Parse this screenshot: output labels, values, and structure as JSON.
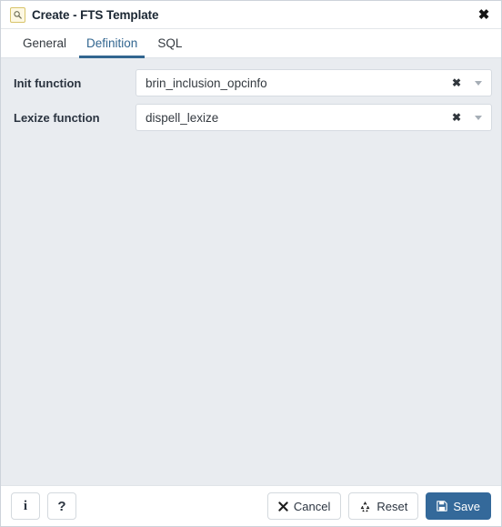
{
  "window": {
    "title": "Create - FTS Template",
    "title_icon": "fts-template-icon",
    "close_label": "✖"
  },
  "tabs": [
    {
      "label": "General",
      "name": "tab-general",
      "active": false
    },
    {
      "label": "Definition",
      "name": "tab-definition",
      "active": true
    },
    {
      "label": "SQL",
      "name": "tab-sql",
      "active": false
    }
  ],
  "fields": [
    {
      "label": "Init function",
      "value": "brin_inclusion_opcinfo",
      "clear_label": "✖",
      "name": "init-function"
    },
    {
      "label": "Lexize function",
      "value": "dispell_lexize",
      "clear_label": "✖",
      "name": "lexize-function"
    }
  ],
  "footer": {
    "info_label": "i",
    "help_label": "?",
    "cancel_label": "Cancel",
    "reset_label": "Reset",
    "save_label": "Save"
  },
  "colors": {
    "accent": "#326690",
    "primary_button": "#34699a",
    "body_background": "#e9ecf0",
    "panel_background": "#ffffff",
    "border": "#d6dbe1",
    "icon_gold": "#d8c46a"
  }
}
